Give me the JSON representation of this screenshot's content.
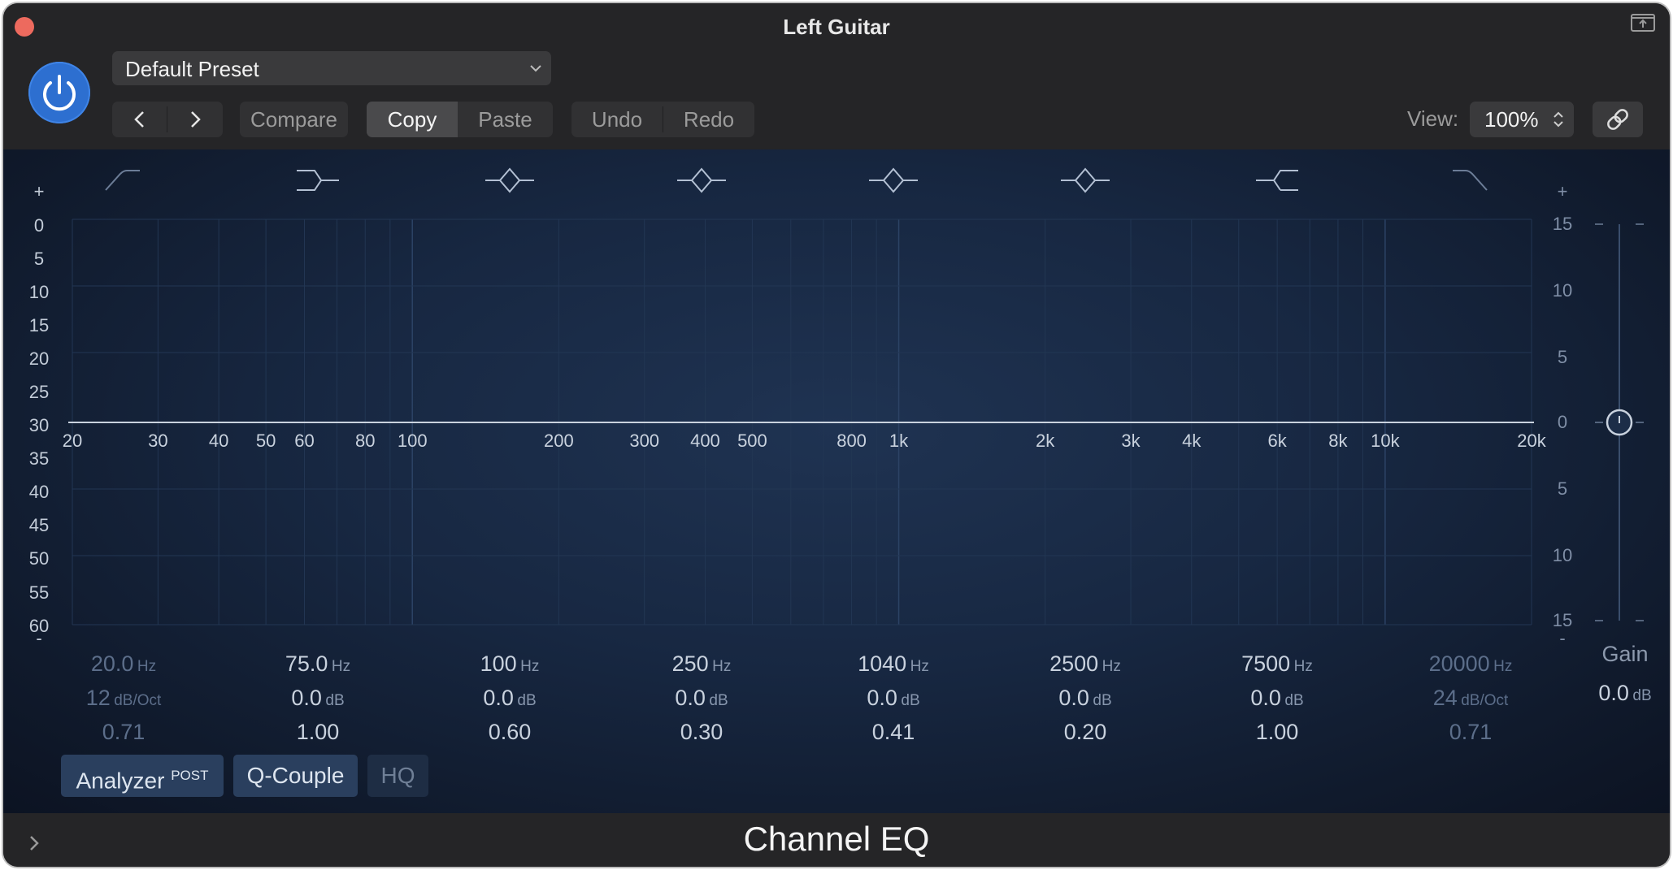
{
  "window": {
    "title": "Left Guitar",
    "footer_title": "Channel EQ"
  },
  "toolbar": {
    "preset": "Default Preset",
    "compare": "Compare",
    "copy": "Copy",
    "paste": "Paste",
    "undo": "Undo",
    "redo": "Redo",
    "view_label": "View:",
    "view_value": "100%"
  },
  "graph": {
    "left_scale": [
      "+",
      "0",
      "5",
      "10",
      "15",
      "20",
      "25",
      "30",
      "35",
      "40",
      "45",
      "50",
      "55",
      "60",
      "-"
    ],
    "right_scale": [
      "+",
      "15",
      "10",
      "5",
      "0",
      "5",
      "10",
      "15",
      "-"
    ],
    "freq_labels": [
      "20",
      "30",
      "40",
      "50",
      "60",
      "80",
      "100",
      "200",
      "300",
      "400",
      "500",
      "800",
      "1k",
      "2k",
      "3k",
      "4k",
      "6k",
      "8k",
      "10k",
      "20k"
    ],
    "band_icons": [
      "highpass-icon",
      "lowshelf-icon",
      "bell-icon",
      "bell-icon",
      "bell-icon",
      "bell-icon",
      "highshelf-icon",
      "lowpass-icon"
    ]
  },
  "bands": [
    {
      "enabled": false,
      "freq": "20.0",
      "freq_unit": "Hz",
      "gain": "12",
      "gain_unit": "dB/Oct",
      "q": "0.71"
    },
    {
      "enabled": true,
      "freq": "75.0",
      "freq_unit": "Hz",
      "gain": "0.0",
      "gain_unit": "dB",
      "q": "1.00"
    },
    {
      "enabled": true,
      "freq": "100",
      "freq_unit": "Hz",
      "gain": "0.0",
      "gain_unit": "dB",
      "q": "0.60"
    },
    {
      "enabled": true,
      "freq": "250",
      "freq_unit": "Hz",
      "gain": "0.0",
      "gain_unit": "dB",
      "q": "0.30"
    },
    {
      "enabled": true,
      "freq": "1040",
      "freq_unit": "Hz",
      "gain": "0.0",
      "gain_unit": "dB",
      "q": "0.41"
    },
    {
      "enabled": true,
      "freq": "2500",
      "freq_unit": "Hz",
      "gain": "0.0",
      "gain_unit": "dB",
      "q": "0.20"
    },
    {
      "enabled": true,
      "freq": "7500",
      "freq_unit": "Hz",
      "gain": "0.0",
      "gain_unit": "dB",
      "q": "1.00"
    },
    {
      "enabled": false,
      "freq": "20000",
      "freq_unit": "Hz",
      "gain": "24",
      "gain_unit": "dB/Oct",
      "q": "0.71"
    }
  ],
  "gain": {
    "label": "Gain",
    "value": "0.0",
    "unit": "dB",
    "level": 0.5
  },
  "buttons": {
    "analyzer": "Analyzer",
    "analyzer_badge": "POST",
    "qcouple": "Q-Couple",
    "hq": "HQ"
  },
  "colors": {
    "power": "#2d6fd0",
    "close": "#ed6a5e",
    "curve": "#c9d2de",
    "background": "#172741"
  }
}
